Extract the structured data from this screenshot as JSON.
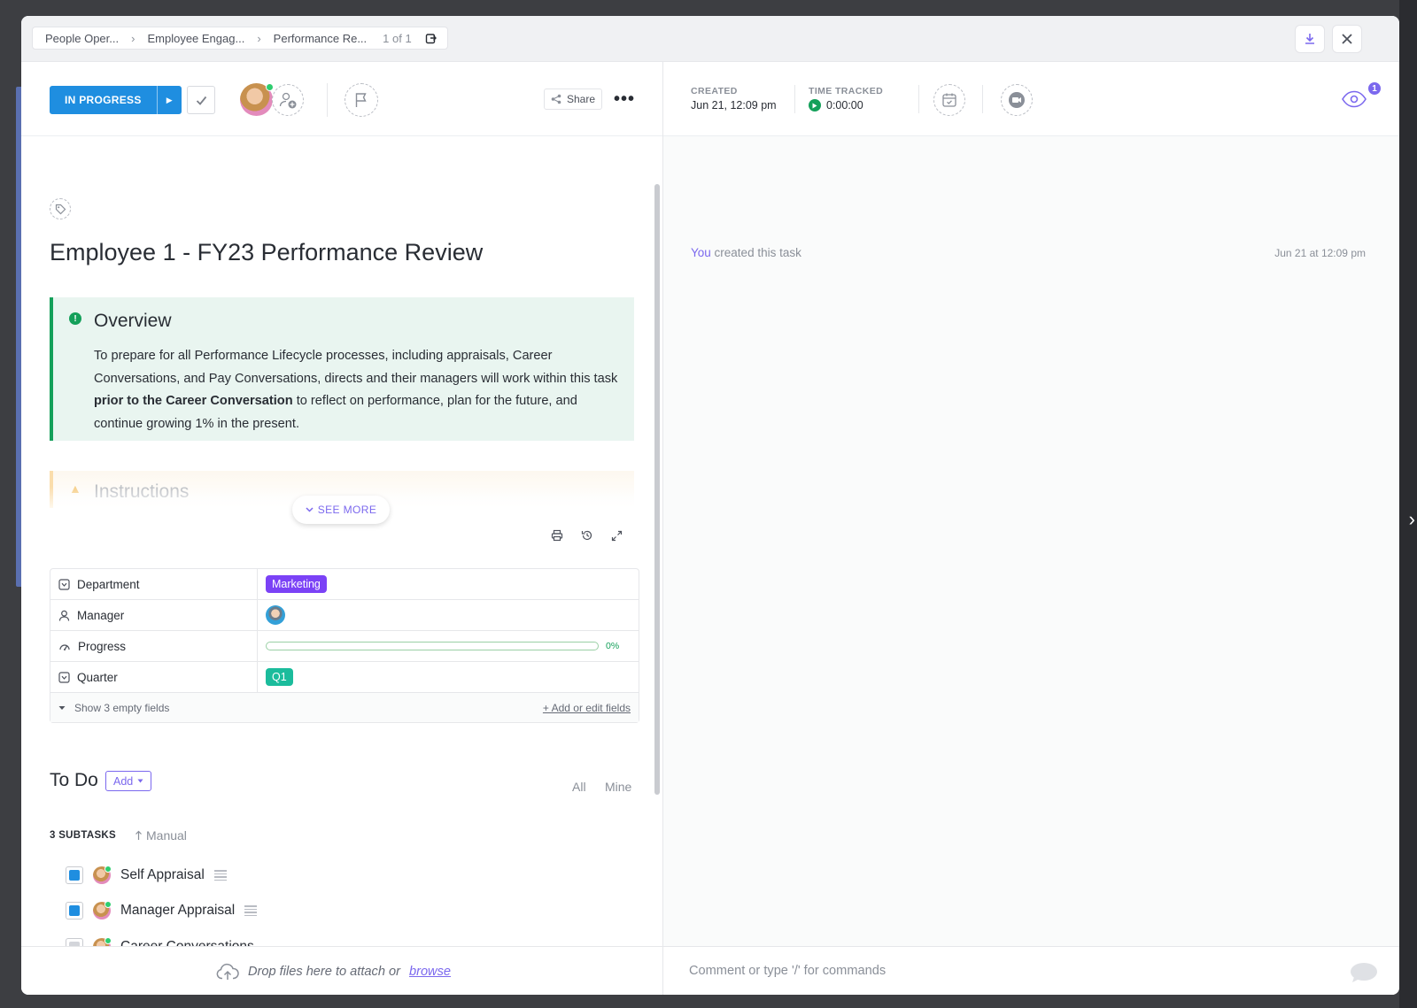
{
  "breadcrumb": {
    "items": [
      "People Oper...",
      "Employee Engag...",
      "Performance Re..."
    ],
    "count": "1 of 1"
  },
  "header": {
    "status_label": "IN PROGRESS",
    "status_color": "#1f8ee0",
    "share_label": "Share",
    "more_label": "•••"
  },
  "task": {
    "title": "Employee 1 - FY23 Performance Review"
  },
  "overview": {
    "title": "Overview",
    "body_part1": "To prepare for all Performance Lifecycle processes, including appraisals, Career Conversations, and Pay Conversations, directs and their managers will work within this task ",
    "body_bold": "prior to the Career Conversation",
    "body_part2": " to reflect on performance, plan for the future, and continue growing 1% in the present."
  },
  "instructions": {
    "title": "Instructions"
  },
  "see_more_label": "SEE MORE",
  "fields": {
    "department": {
      "label": "Department",
      "value": "Marketing",
      "color": "#7b42f6"
    },
    "manager": {
      "label": "Manager"
    },
    "progress": {
      "label": "Progress",
      "value": "0%",
      "fraction": 0
    },
    "quarter": {
      "label": "Quarter",
      "value": "Q1",
      "color": "#1bbc9c"
    },
    "show_empty": "Show 3 empty fields",
    "add_edit": "+ Add or edit fields"
  },
  "todo": {
    "title": "To Do",
    "add_label": "Add",
    "filter_all": "All",
    "filter_mine": "Mine",
    "subtasks_label": "3 SUBTASKS",
    "sort_label": "Manual",
    "subtasks": [
      {
        "name": "Self Appraisal",
        "status_color": "#1f8ee0"
      },
      {
        "name": "Manager Appraisal",
        "status_color": "#1f8ee0"
      },
      {
        "name": "Career Conversations",
        "status_color": "#d3d5da"
      }
    ]
  },
  "attach": {
    "text": "Drop files here to attach or",
    "browse": "browse"
  },
  "meta": {
    "created_label": "CREATED",
    "created_value": "Jun 21, 12:09 pm",
    "time_label": "TIME TRACKED",
    "time_value": "0:00:00",
    "watchers_count": "1"
  },
  "activity": {
    "actor": "You",
    "action": "created this task",
    "time": "Jun 21 at 12:09 pm"
  },
  "comment_placeholder": "Comment or type '/' for commands"
}
